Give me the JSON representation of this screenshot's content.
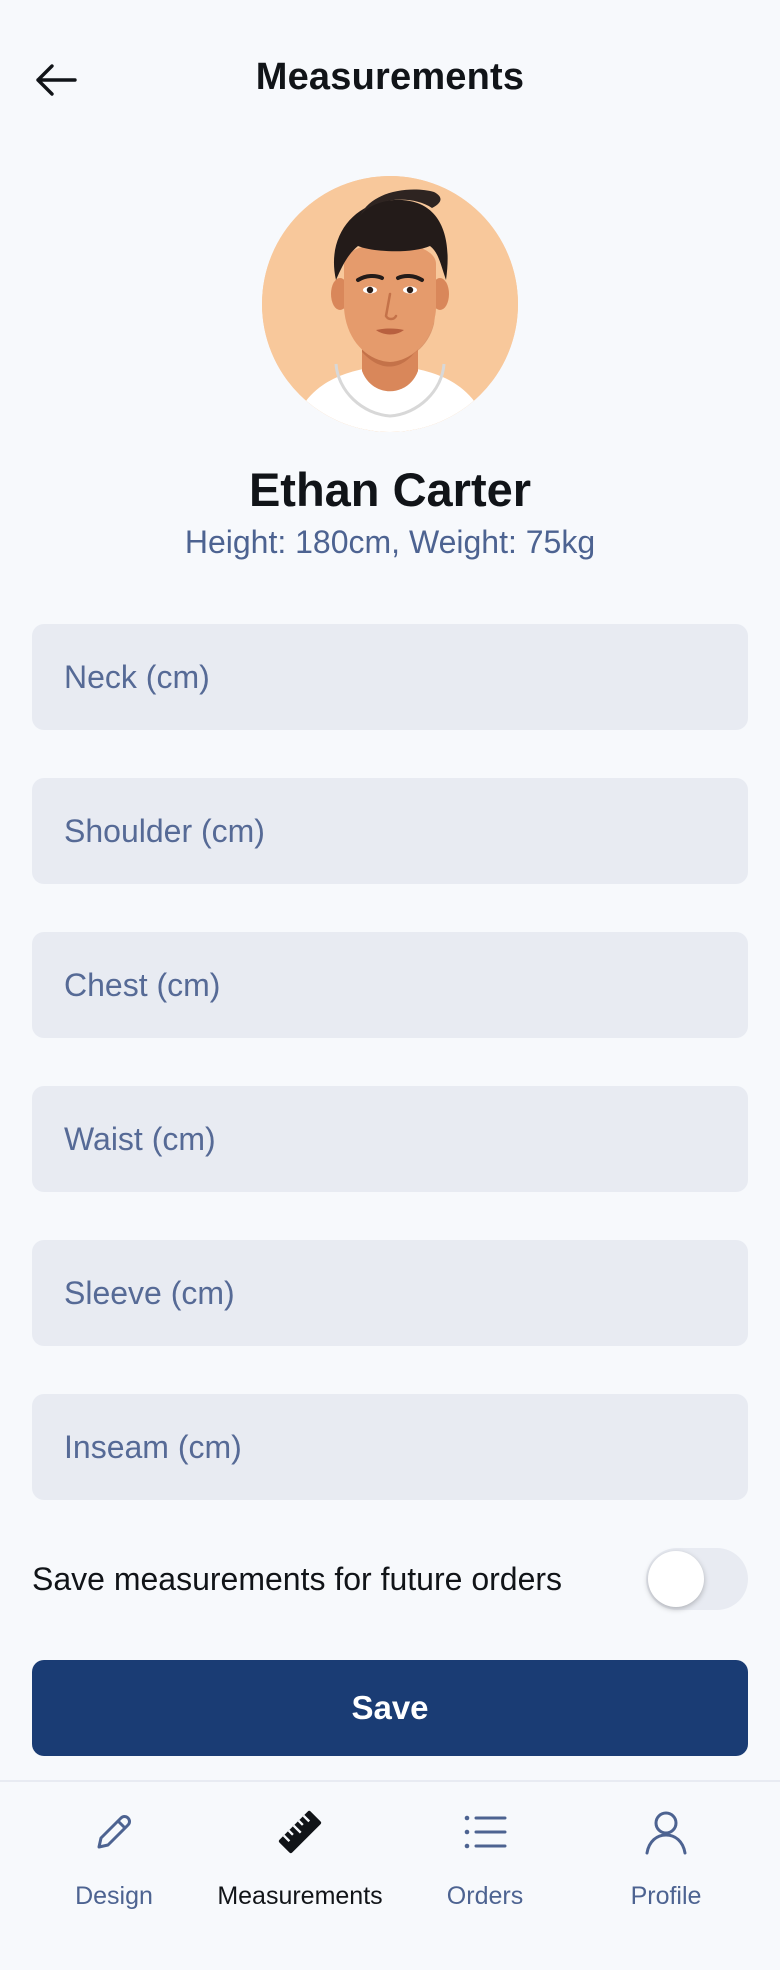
{
  "header": {
    "title": "Measurements",
    "back_icon": "arrow-left-icon"
  },
  "profile": {
    "name": "Ethan Carter",
    "stats": "Height: 180cm, Weight: 75kg"
  },
  "fields": {
    "neck": {
      "placeholder": "Neck (cm)",
      "value": ""
    },
    "shoulder": {
      "placeholder": "Shoulder (cm)",
      "value": ""
    },
    "chest": {
      "placeholder": "Chest (cm)",
      "value": ""
    },
    "waist": {
      "placeholder": "Waist (cm)",
      "value": ""
    },
    "sleeve": {
      "placeholder": "Sleeve (cm)",
      "value": ""
    },
    "inseam": {
      "placeholder": "Inseam (cm)",
      "value": ""
    }
  },
  "save_toggle": {
    "label": "Save measurements for future orders",
    "on": false
  },
  "save_button": {
    "label": "Save"
  },
  "nav": {
    "items": [
      {
        "label": "Design",
        "icon": "pencil-icon",
        "active": false
      },
      {
        "label": "Measurements",
        "icon": "ruler-icon",
        "active": true
      },
      {
        "label": "Orders",
        "icon": "list-icon",
        "active": false
      },
      {
        "label": "Profile",
        "icon": "user-icon",
        "active": false
      }
    ]
  },
  "colors": {
    "primary": "#1a3c74",
    "background": "#f7f9fc",
    "field_bg": "#e8ebf2",
    "muted_text": "#4d6391",
    "avatar_bg": "#f8c89b"
  }
}
